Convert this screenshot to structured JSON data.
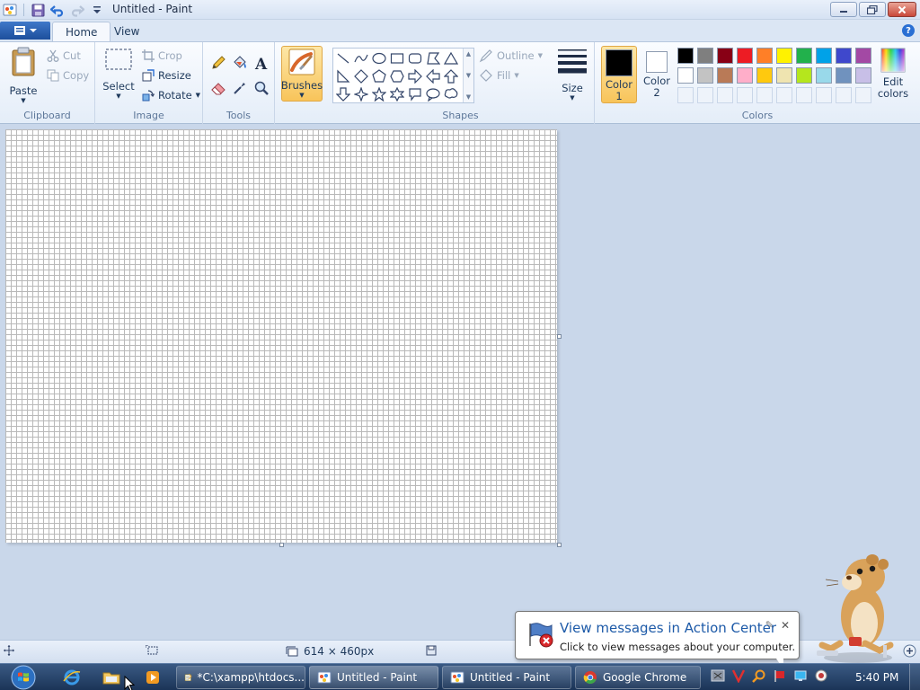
{
  "window": {
    "title": "Untitled - Paint"
  },
  "tabs": [
    {
      "label": "Home",
      "active": true
    },
    {
      "label": "View",
      "active": false
    }
  ],
  "ribbon": {
    "clipboard": {
      "label": "Clipboard",
      "paste": "Paste",
      "cut": "Cut",
      "copy": "Copy"
    },
    "image": {
      "label": "Image",
      "select": "Select",
      "crop": "Crop",
      "resize": "Resize",
      "rotate": "Rotate"
    },
    "tools": {
      "label": "Tools"
    },
    "brushes": {
      "label": "Brushes"
    },
    "shapes": {
      "label": "Shapes",
      "outline": "Outline",
      "fill": "Fill"
    },
    "size": {
      "label": "Size"
    },
    "colors": {
      "label": "Colors",
      "color1": "Color 1",
      "color2": "Color 2",
      "edit": "Edit colors",
      "color1_value": "#000000",
      "color2_value": "#ffffff",
      "palette_row1": [
        "#000000",
        "#7f7f7f",
        "#880015",
        "#ed1c24",
        "#ff7f27",
        "#fff200",
        "#22b14c",
        "#00a2e8",
        "#3f48cc",
        "#a349a4"
      ],
      "palette_row2": [
        "#ffffff",
        "#c3c3c3",
        "#b97a57",
        "#ffaec9",
        "#ffc90e",
        "#efe4b0",
        "#b5e61d",
        "#99d9ea",
        "#7092be",
        "#c8bfe7"
      ]
    }
  },
  "status": {
    "dimensions": "614 × 460px"
  },
  "notification": {
    "title": "View messages in Action Center",
    "text": "Click to view messages about your computer."
  },
  "taskbar": {
    "tasks": [
      {
        "label": "*C:\\xampp\\htdocs..."
      },
      {
        "label": "Untitled - Paint"
      },
      {
        "label": "Untitled - Paint"
      },
      {
        "label": "Google Chrome"
      }
    ],
    "clock": "5:40 PM"
  }
}
